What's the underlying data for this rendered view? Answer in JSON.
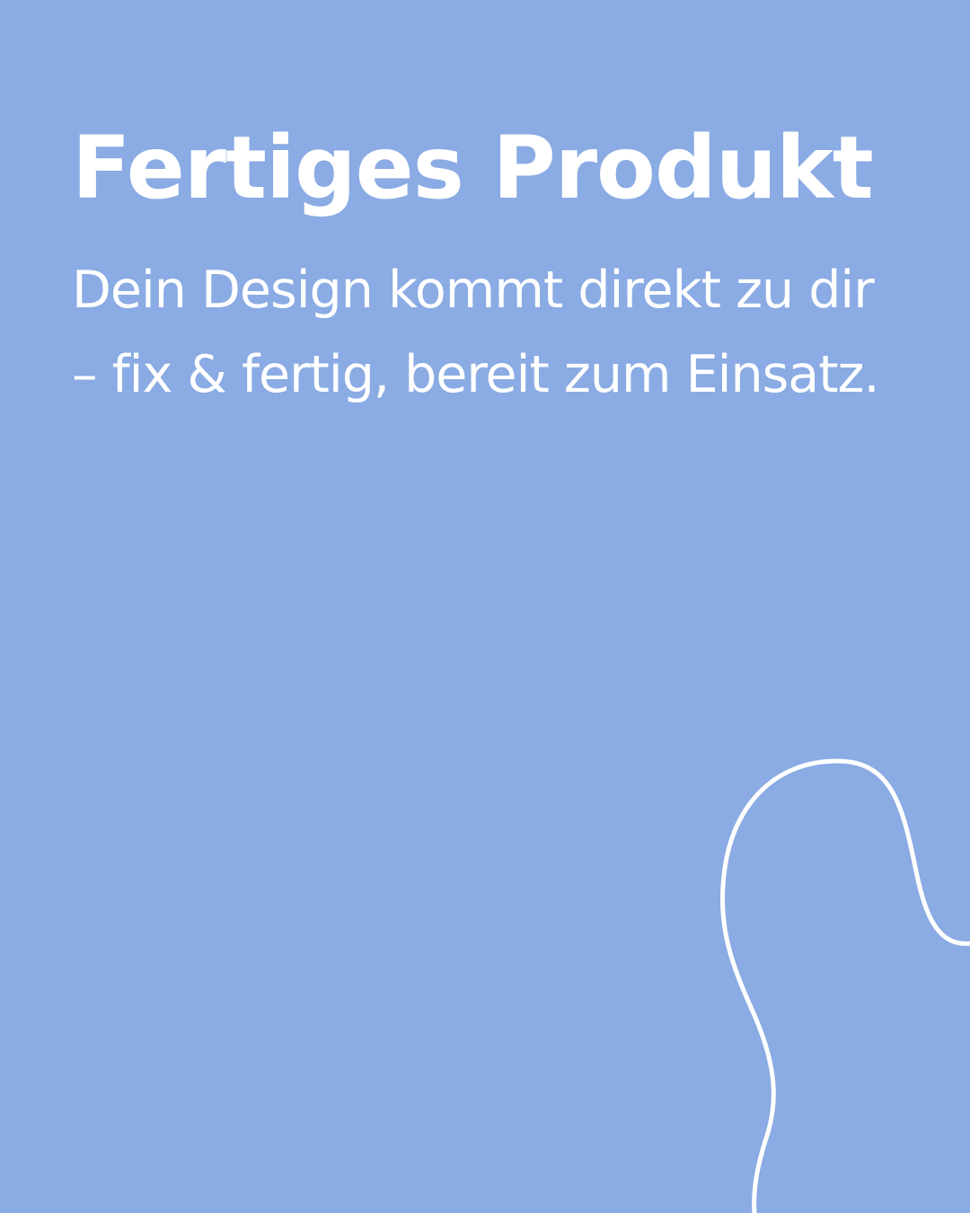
{
  "slide": {
    "title": "Fertiges Produkt",
    "body": "Dein Design kommt direkt zu dir – fix & fertig, bereit zum Einsatz.",
    "background_color": "#8aabe3",
    "text_color": "#ffffff",
    "decoration": "white-wavy-line"
  }
}
